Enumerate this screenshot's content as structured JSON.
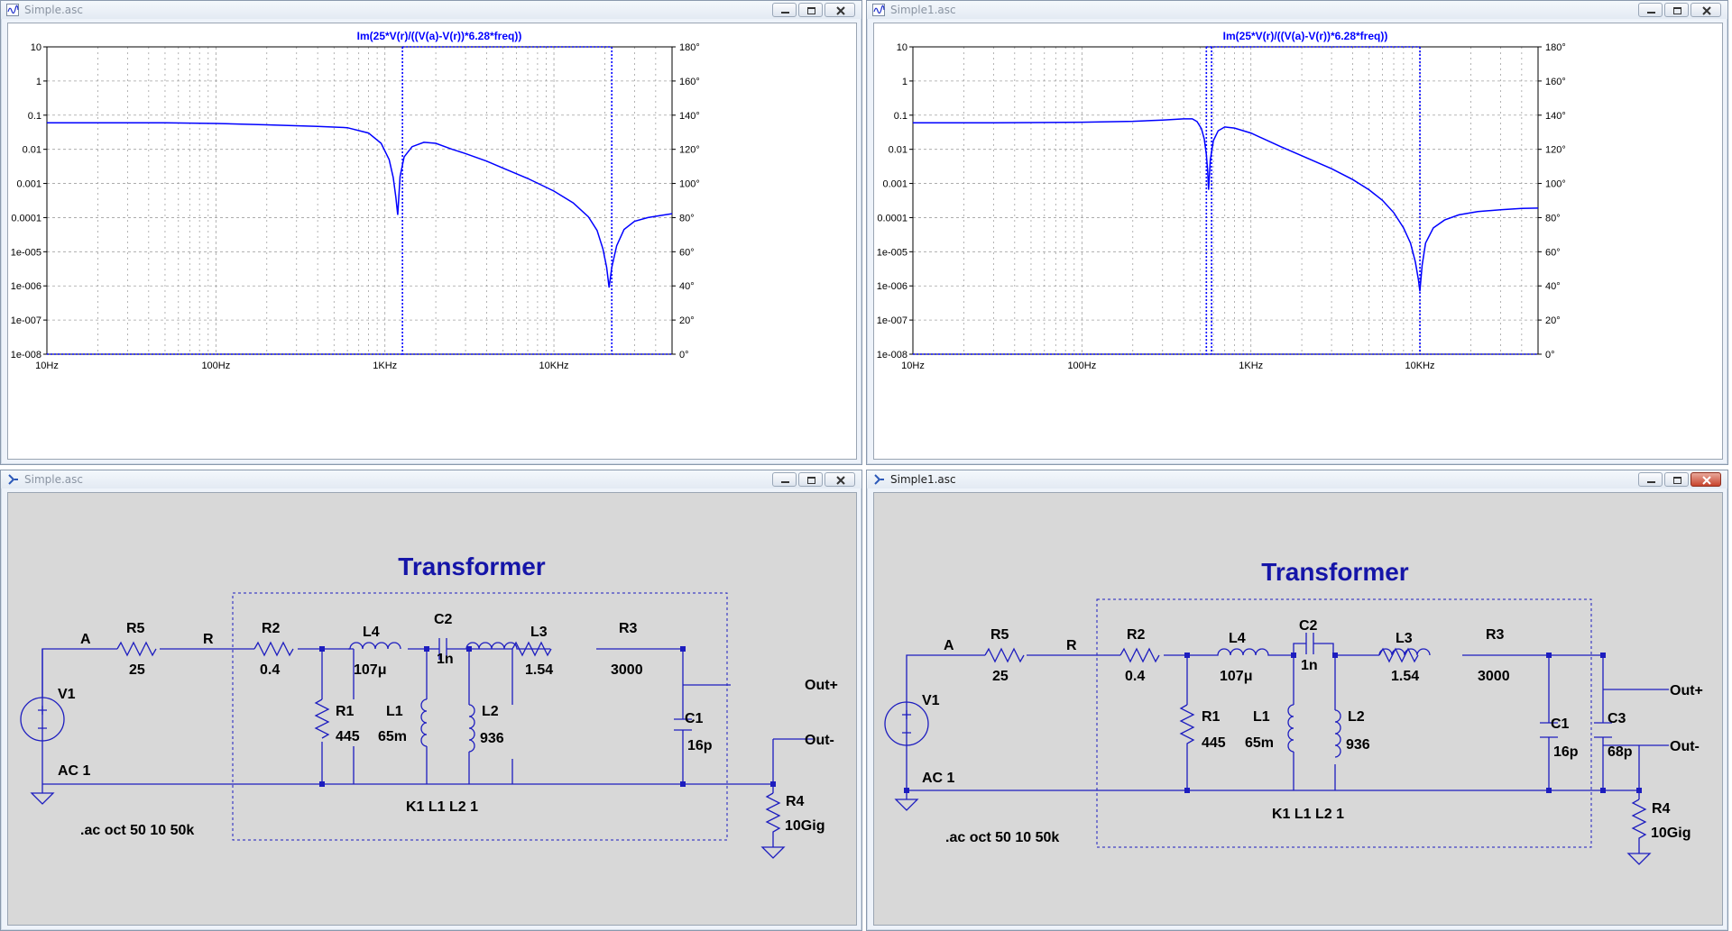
{
  "plot_windows": [
    {
      "title": "Simple.asc",
      "trace_label": "Im(25*V(r)/((V(a)-V(r))*6.28*freq))",
      "chart_data": {
        "type": "line",
        "title": "Im(25*V(r)/((V(a)-V(r))*6.28*freq))",
        "x_scale": "log",
        "xlim": [
          10,
          50000
        ],
        "x_tick_labels": [
          "10Hz",
          "100Hz",
          "1KHz",
          "10KHz"
        ],
        "y_scale": "log",
        "ylim": [
          1e-08,
          10
        ],
        "y_tick_labels": [
          "10",
          "1",
          "0.1",
          "0.01",
          "0.001",
          "0.0001",
          "1e-005",
          "1e-006",
          "1e-007",
          "1e-008"
        ],
        "y2_tick_labels": [
          "180°",
          "160°",
          "140°",
          "120°",
          "100°",
          "80°",
          "60°",
          "40°",
          "20°",
          "0°"
        ],
        "grid": true,
        "series": [
          {
            "color": "#0000ff",
            "x": [
              10,
              20,
              50,
              100,
              200,
              400,
              600,
              800,
              950,
              1060,
              1120,
              1160,
              1190,
              1230,
              1300,
              1450,
              1700,
              2000,
              2500,
              3000,
              4000,
              5000,
              7000,
              10000,
              13000,
              16000,
              18000,
              19500,
              20500,
              21200,
              22000,
              23500,
              26000,
              30000,
              36000,
              44000,
              50000
            ],
            "y": [
              0.06,
              0.06,
              0.06,
              0.057,
              0.052,
              0.047,
              0.043,
              0.03,
              0.015,
              0.005,
              0.0015,
              0.0004,
              0.00012,
              0.0016,
              0.006,
              0.012,
              0.016,
              0.015,
              0.01,
              0.0075,
              0.0045,
              0.0028,
              0.0014,
              0.0006,
              0.00027,
              0.000105,
              4.2e-05,
              1.2e-05,
              3.5e-06,
              9e-07,
              3.5e-06,
              1.5e-05,
              4.5e-05,
              7.8e-05,
              0.0001,
              0.000118,
              0.00013
            ]
          }
        ],
        "cursor_lines_x": [
          1270,
          22000
        ]
      }
    },
    {
      "title": "Simple1.asc",
      "trace_label": "Im(25*V(r)/((V(a)-V(r))*6.28*freq))",
      "chart_data": {
        "type": "line",
        "title": "Im(25*V(r)/((V(a)-V(r))*6.28*freq))",
        "x_scale": "log",
        "xlim": [
          10,
          50000
        ],
        "x_tick_labels": [
          "10Hz",
          "100Hz",
          "1KHz",
          "10KHz"
        ],
        "y_scale": "log",
        "ylim": [
          1e-08,
          10
        ],
        "y_tick_labels": [
          "10",
          "1",
          "0.1",
          "0.01",
          "0.001",
          "0.0001",
          "1e-005",
          "1e-006",
          "1e-007",
          "1e-008"
        ],
        "y2_tick_labels": [
          "180°",
          "160°",
          "140°",
          "120°",
          "100°",
          "80°",
          "60°",
          "40°",
          "20°",
          "0°"
        ],
        "grid": true,
        "series": [
          {
            "color": "#0000ff",
            "x": [
              10,
              30,
              100,
              200,
              300,
              400,
              450,
              480,
              510,
              530,
              545,
              555,
              562,
              575,
              600,
              640,
              700,
              800,
              1000,
              1500,
              2000,
              3000,
              4000,
              5000,
              6000,
              7000,
              8000,
              8800,
              9400,
              9800,
              10000,
              10300,
              10800,
              12000,
              14000,
              17000,
              22000,
              30000,
              40000,
              50000
            ],
            "y": [
              0.06,
              0.06,
              0.062,
              0.066,
              0.072,
              0.078,
              0.078,
              0.065,
              0.04,
              0.02,
              0.007,
              0.0022,
              0.00065,
              0.005,
              0.018,
              0.035,
              0.045,
              0.042,
              0.03,
              0.012,
              0.0065,
              0.0027,
              0.0013,
              0.00065,
              0.00032,
              0.00014,
              5e-05,
              1.8e-05,
              5e-06,
              1.5e-06,
              7e-07,
              4e-06,
              1.8e-05,
              5e-05,
              8.5e-05,
              0.00012,
              0.00015,
              0.00017,
              0.000185,
              0.00019
            ]
          }
        ],
        "cursor_lines_x": [
          545,
          585,
          10000
        ]
      }
    }
  ],
  "schematic_windows": [
    {
      "title": "Simple.asc",
      "heading": "Transformer",
      "net_a": "A",
      "net_r": "R",
      "components": {
        "R5": {
          "name": "R5",
          "value": "25"
        },
        "R2": {
          "name": "R2",
          "value": "0.4"
        },
        "L4": {
          "name": "L4",
          "value": "107μ"
        },
        "C2": {
          "name": "C2",
          "value": "1n"
        },
        "L3": {
          "name": "L3",
          "value": "1.54"
        },
        "R3": {
          "name": "R3",
          "value": "3000"
        },
        "R1": {
          "name": "R1",
          "value": "445"
        },
        "L1": {
          "name": "L1",
          "value": "65m"
        },
        "L2": {
          "name": "L2",
          "value": "936"
        },
        "C1": {
          "name": "C1",
          "value": "16p"
        },
        "R4": {
          "name": "R4",
          "value": "10Gig"
        },
        "V1": {
          "name": "V1",
          "value": "AC 1"
        }
      },
      "out_plus": "Out+",
      "out_minus": "Out-",
      "coupling": "K1 L1 L2 1",
      "directive": ".ac oct 50 10 50k"
    },
    {
      "title": "Simple1.asc",
      "heading": "Transformer",
      "net_a": "A",
      "net_r": "R",
      "components": {
        "R5": {
          "name": "R5",
          "value": "25"
        },
        "R2": {
          "name": "R2",
          "value": "0.4"
        },
        "L4": {
          "name": "L4",
          "value": "107μ"
        },
        "C2": {
          "name": "C2",
          "value": "1n"
        },
        "L3": {
          "name": "L3",
          "value": "1.54"
        },
        "R3": {
          "name": "R3",
          "value": "3000"
        },
        "R1": {
          "name": "R1",
          "value": "445"
        },
        "L1": {
          "name": "L1",
          "value": "65m"
        },
        "L2": {
          "name": "L2",
          "value": "936"
        },
        "C1": {
          "name": "C1",
          "value": "16p"
        },
        "C3": {
          "name": "C3",
          "value": "68p"
        },
        "R4": {
          "name": "R4",
          "value": "10Gig"
        },
        "V1": {
          "name": "V1",
          "value": "AC 1"
        }
      },
      "out_plus": "Out+",
      "out_minus": "Out-",
      "coupling": "K1 L1 L2 1",
      "directive": ".ac oct 50 10 50k"
    }
  ],
  "colors": {
    "trace": "#0000ff",
    "axis_text": "#000000",
    "schematic_wire": "#1d1dbf",
    "schematic_bg": "#d8d8d8",
    "heading": "#1515a8"
  }
}
